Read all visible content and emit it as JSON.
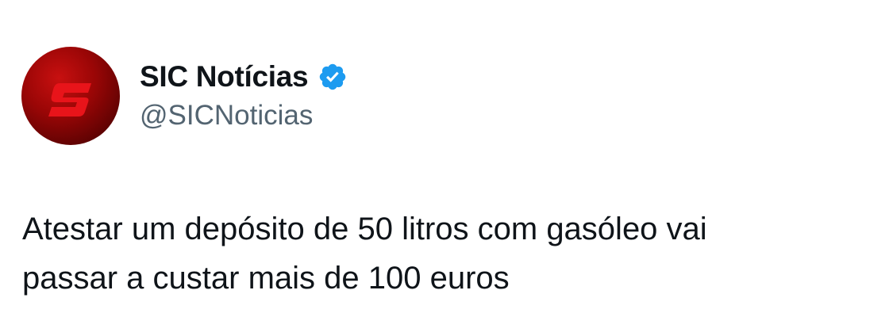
{
  "tweet": {
    "author": {
      "display_name": "SIC Notícias",
      "handle": "@SICNoticias",
      "verified": true,
      "avatar_icon": "sic-logo-icon",
      "verified_icon": "verified-badge-icon",
      "brand_color": "#d40f0f",
      "verified_color": "#1d9bf0"
    },
    "text_lines": [
      "Atestar um depósito de 50 litros com gasóleo vai",
      "passar a custar mais de 100 euros"
    ]
  }
}
